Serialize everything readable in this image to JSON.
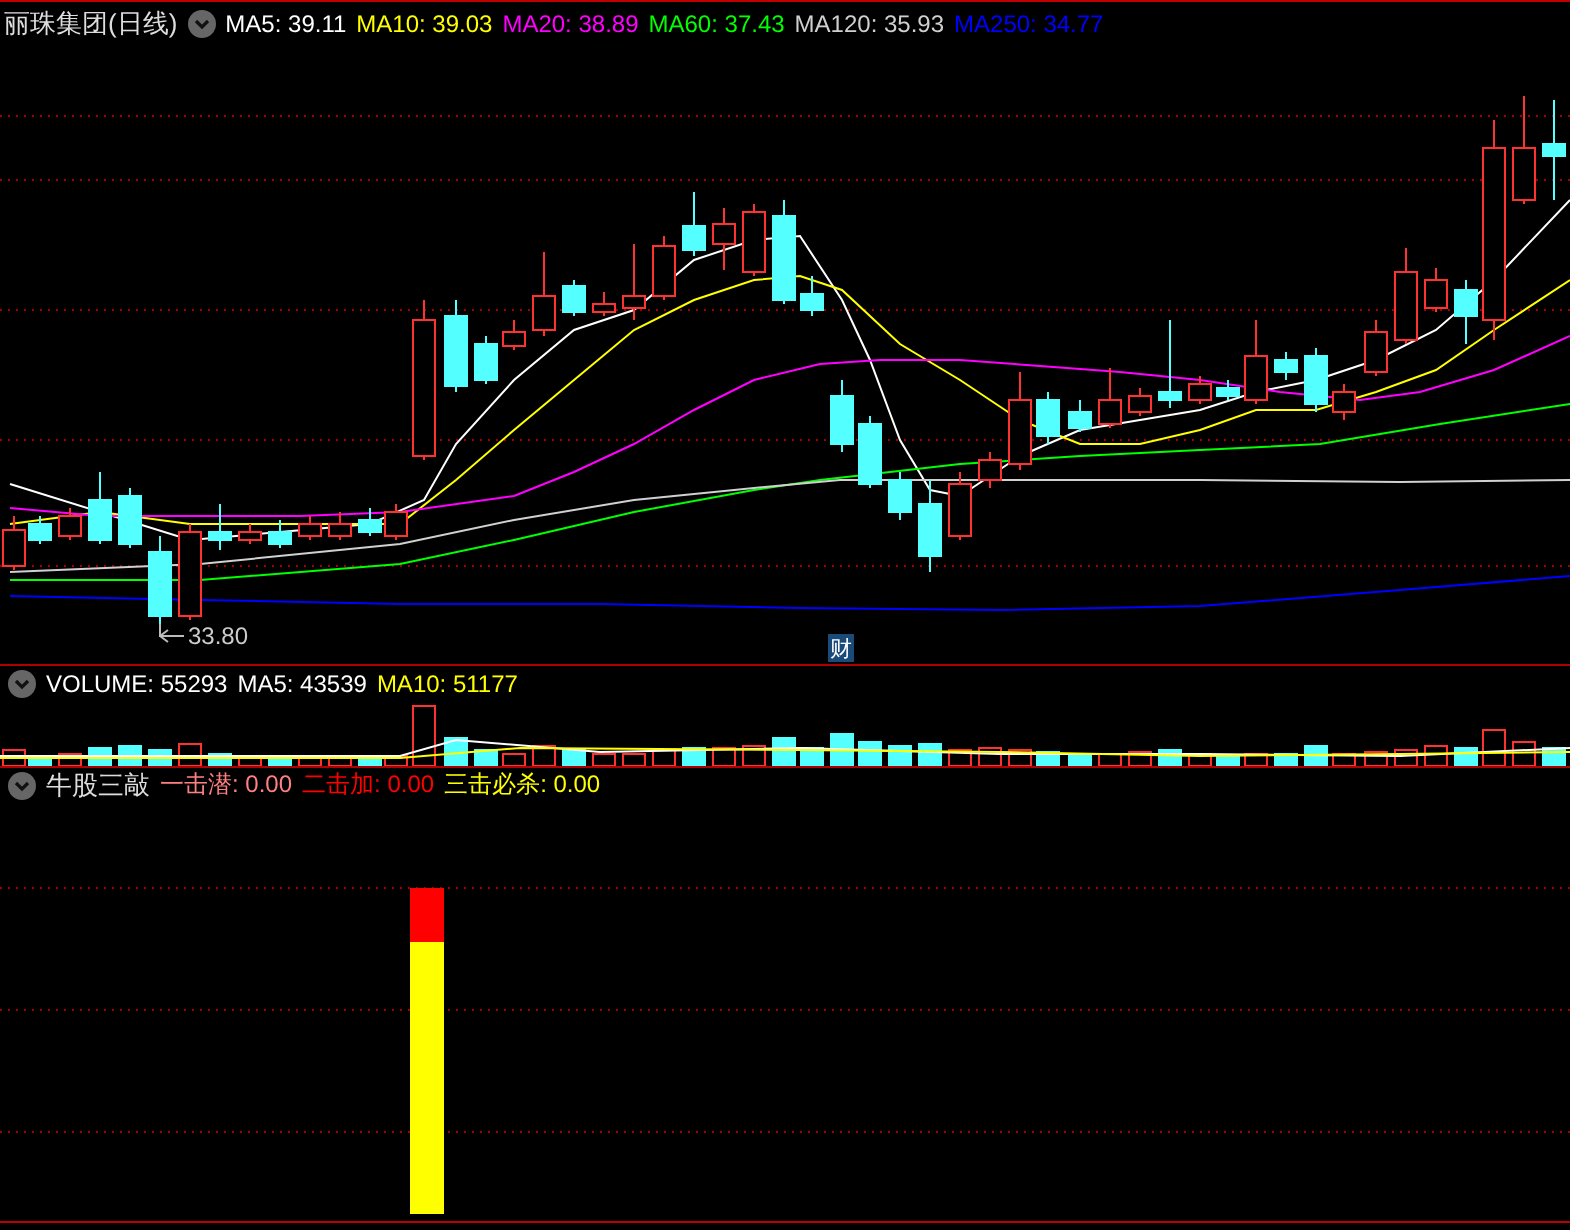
{
  "main_panel": {
    "title": "丽珠集团(日线)",
    "indicators": [
      {
        "label": "MA5: 39.11",
        "color": "#ffffff"
      },
      {
        "label": "MA10: 39.03",
        "color": "#ffff00"
      },
      {
        "label": "MA20: 38.89",
        "color": "#ff00ff"
      },
      {
        "label": "MA60: 37.43",
        "color": "#00ff00"
      },
      {
        "label": "MA120: 35.93",
        "color": "#d0d0d0"
      },
      {
        "label": "MA250: 34.77",
        "color": "#0000ff"
      }
    ],
    "low_label": "33.80",
    "marker": "财"
  },
  "volume_panel": {
    "indicators": [
      {
        "label": "VOLUME: 55293",
        "color": "#ffffff"
      },
      {
        "label": "MA5: 43539",
        "color": "#ffffff"
      },
      {
        "label": "MA10: 51177",
        "color": "#ffff00"
      }
    ]
  },
  "signal_panel": {
    "title": "牛股三敲",
    "indicators": [
      {
        "label": "一击潜: 0.00",
        "color": "#ff8080"
      },
      {
        "label": "二击加: 0.00",
        "color": "#ff0000"
      },
      {
        "label": "三击必杀: 0.00",
        "color": "#ffff00"
      }
    ]
  }
}
